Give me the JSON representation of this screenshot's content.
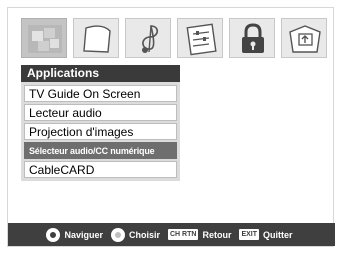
{
  "icons": [
    {
      "name": "applications-icon",
      "active": true
    },
    {
      "name": "picture-icon",
      "active": false
    },
    {
      "name": "audio-icon",
      "active": false
    },
    {
      "name": "setup-icon",
      "active": false
    },
    {
      "name": "lock-icon",
      "active": false
    },
    {
      "name": "preferences-icon",
      "active": false
    }
  ],
  "menu": {
    "title": "Applications",
    "items": [
      {
        "label": "TV Guide On Screen"
      },
      {
        "label": "Lecteur audio"
      },
      {
        "label": "Projection d'images"
      },
      {
        "label": "Sélecteur audio/CC numérique",
        "selected": true
      },
      {
        "label": "CableCARD"
      }
    ]
  },
  "help": {
    "navigate": "Naviguer",
    "select": "Choisir",
    "return_key": "CH RTN",
    "return": "Retour",
    "exit_key": "EXIT",
    "exit": "Quitter"
  },
  "colors": {
    "menu_title_bg": "#3a3a3a",
    "selected_item_bg": "#6e6e6e",
    "help_bar_bg": "#3f3f3f"
  }
}
